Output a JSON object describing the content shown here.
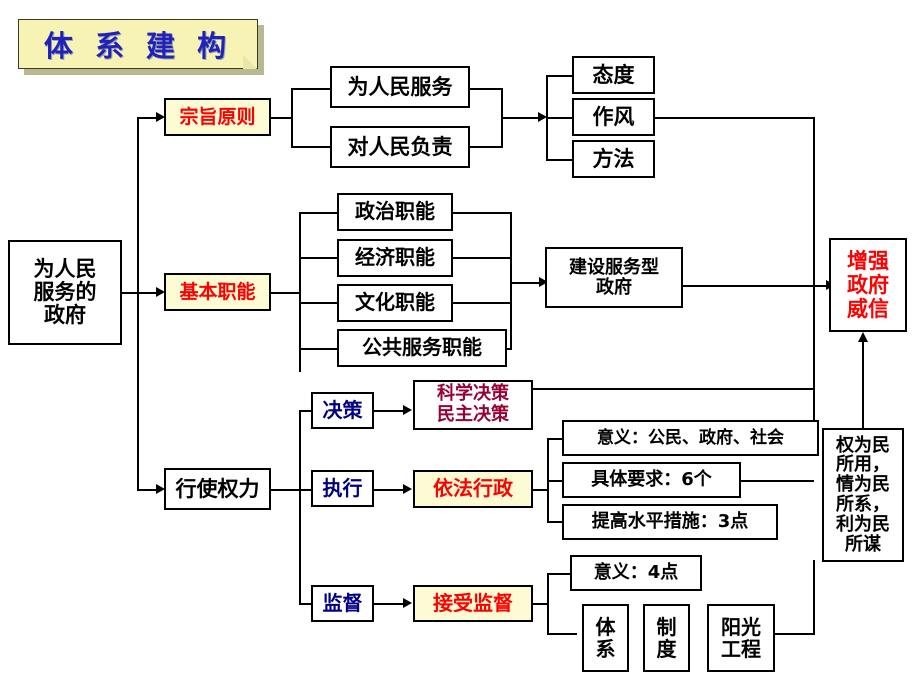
{
  "title": {
    "text": "体 系 建 构",
    "color": "#2222bb",
    "fill": "#f6f3b4"
  },
  "nodes": {
    "root": "为人民\n服务的\n政府",
    "principle": "宗旨原则",
    "serve_people": "为人民服务",
    "responsible": "对人民负责",
    "attitude": "态度",
    "style": "作风",
    "method": "方法",
    "basic_functions": "基本职能",
    "political_function": "政治职能",
    "economic_function": "经济职能",
    "cultural_function": "文化职能",
    "public_service_function": "公共服务职能",
    "service_government": "建设服务型\n政府",
    "exercise_power": "行使权力",
    "decision": "决策",
    "execution": "执行",
    "supervision": "监督",
    "scientific_democratic": "科学决策\n民主决策",
    "rule_by_law": "依法行政",
    "accept_supervision": "接受监督",
    "significance_three": "意义：公民、政府、社会",
    "requirements_six": "具体要求：6个",
    "measures_three": "提高水平措施：3点",
    "significance_four": "意义：4点",
    "system": "体\n系",
    "institution": "制\n度",
    "sunshine_project": "阳光\n工程",
    "people_oriented": "权为民\n所用，\n情为民\n所系，\n利为民\n所谋",
    "enhance_credibility": "增强\n政府\n威信"
  },
  "colors": {
    "highlight_fill": "#fdfbd4",
    "red_text": "#ff0000",
    "dark_red_text": "#990033",
    "blue_text": "#000080",
    "line": "#000000"
  }
}
